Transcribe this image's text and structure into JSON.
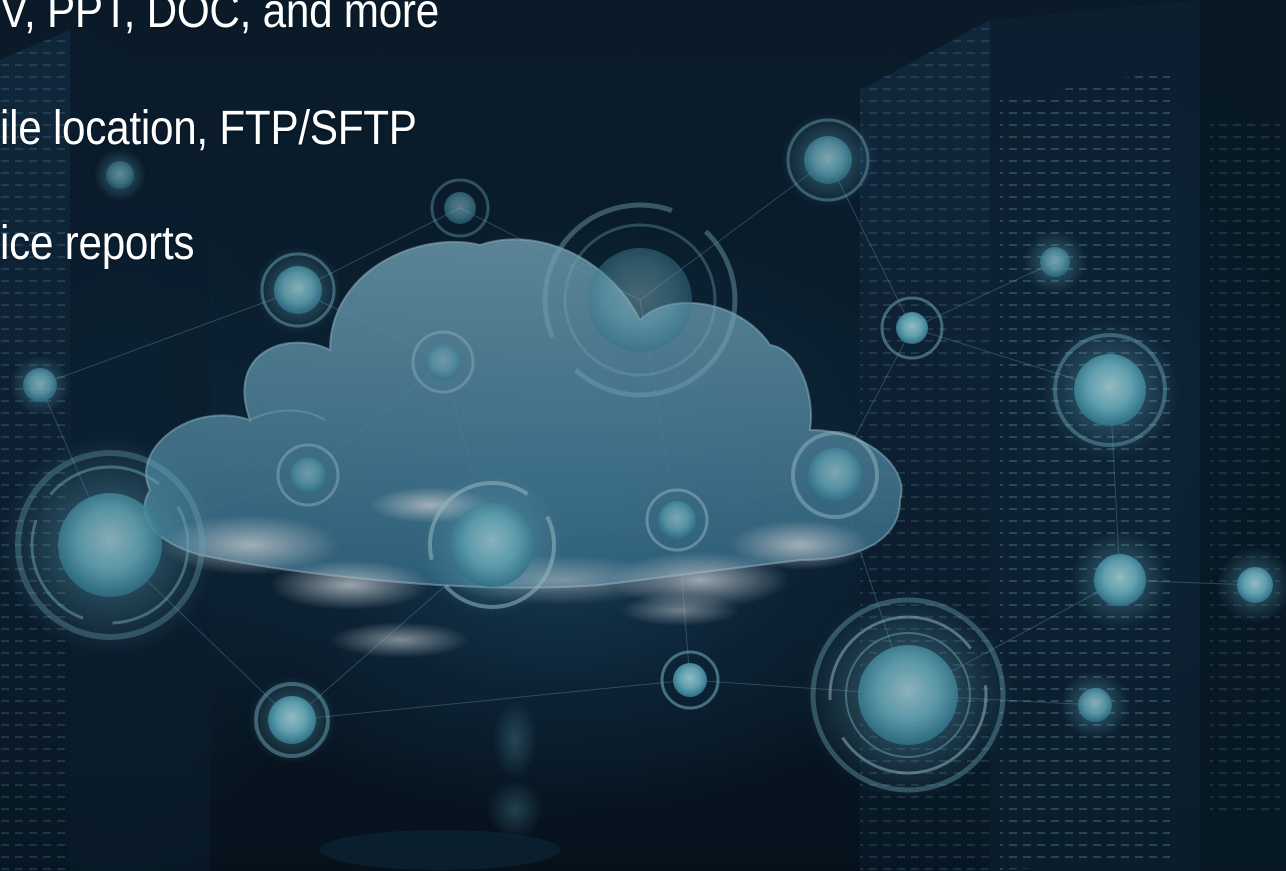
{
  "slide": {
    "bullets": [
      "V, PPT, DOC, and more",
      "ile location, FTP/SFTP",
      "ice reports"
    ],
    "background": {
      "icons": [
        "cloud-icon",
        "server-rack-icon",
        "network-node-icon"
      ]
    }
  },
  "colors": {
    "background_dark": "#08131f",
    "background_blue": "#1f4d6c",
    "cloud_fill": "#6aa8c4",
    "node_glow": "#8fd6e6",
    "text": "#ffffff"
  }
}
